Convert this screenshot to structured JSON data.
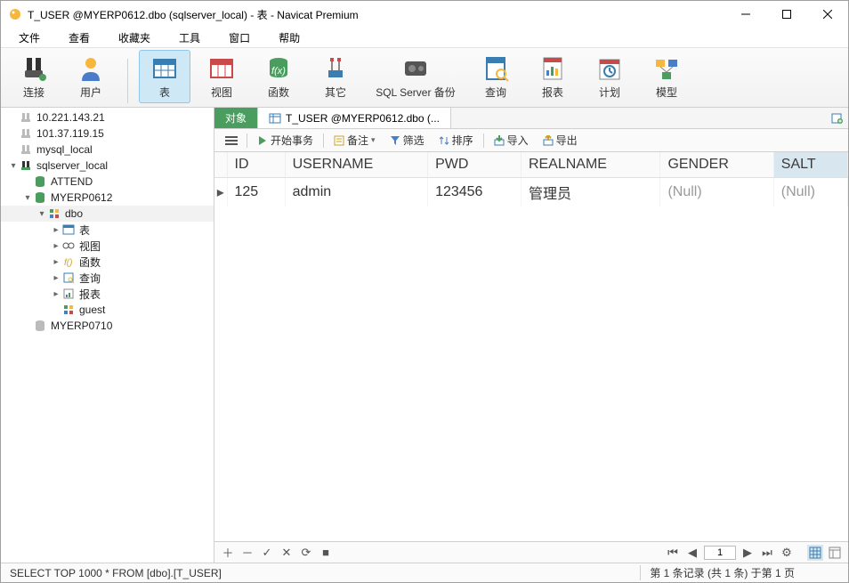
{
  "window": {
    "title": "T_USER @MYERP0612.dbo (sqlserver_local) - 表 - Navicat Premium"
  },
  "menu": [
    "文件",
    "查看",
    "收藏夹",
    "工具",
    "窗口",
    "帮助"
  ],
  "toolbar": [
    {
      "key": "conn",
      "label": "连接"
    },
    {
      "key": "user",
      "label": "用户"
    },
    {
      "key": "table",
      "label": "表",
      "active": true
    },
    {
      "key": "view",
      "label": "视图"
    },
    {
      "key": "func",
      "label": "函数"
    },
    {
      "key": "other",
      "label": "其它"
    },
    {
      "key": "backup",
      "label": "SQL Server 备份"
    },
    {
      "key": "query",
      "label": "查询"
    },
    {
      "key": "report",
      "label": "报表"
    },
    {
      "key": "plan",
      "label": "计划"
    },
    {
      "key": "model",
      "label": "模型"
    }
  ],
  "tree": [
    {
      "d": 0,
      "t": "",
      "l": "10.221.143.21",
      "i": "conn-off"
    },
    {
      "d": 0,
      "t": "",
      "l": "101.37.119.15",
      "i": "conn-off"
    },
    {
      "d": 0,
      "t": "",
      "l": "mysql_local",
      "i": "conn-off"
    },
    {
      "d": 0,
      "t": "v",
      "l": "sqlserver_local",
      "i": "conn-on"
    },
    {
      "d": 1,
      "t": "",
      "l": "ATTEND",
      "i": "db"
    },
    {
      "d": 1,
      "t": "v",
      "l": "MYERP0612",
      "i": "db"
    },
    {
      "d": 2,
      "t": "v",
      "l": "dbo",
      "i": "schema",
      "sel": true
    },
    {
      "d": 3,
      "t": ">",
      "l": "表",
      "i": "tbl"
    },
    {
      "d": 3,
      "t": ">",
      "l": "视图",
      "i": "vw"
    },
    {
      "d": 3,
      "t": ">",
      "l": "函数",
      "i": "fn"
    },
    {
      "d": 3,
      "t": ">",
      "l": "查询",
      "i": "qry"
    },
    {
      "d": 3,
      "t": ">",
      "l": "报表",
      "i": "rpt"
    },
    {
      "d": 3,
      "t": "",
      "l": "guest",
      "i": "schema"
    },
    {
      "d": 1,
      "t": "",
      "l": "MYERP0710",
      "i": "db-off"
    }
  ],
  "tabs": {
    "obj": "对象",
    "open": "T_USER @MYERP0612.dbo (..."
  },
  "ops": {
    "begin": "开始事务",
    "memo": "备注",
    "filter": "筛选",
    "sort": "排序",
    "import": "导入",
    "export": "导出"
  },
  "columns": [
    "ID",
    "USERNAME",
    "PWD",
    "REALNAME",
    "GENDER",
    "SALT"
  ],
  "rows": [
    {
      "ID": "125",
      "USERNAME": "admin",
      "PWD": "123456",
      "REALNAME": "管理员",
      "GENDER": "(Null)",
      "SALT": "(Null)"
    }
  ],
  "null_cols": [
    "GENDER",
    "SALT"
  ],
  "pager": {
    "page": "1"
  },
  "status": {
    "sql": "SELECT TOP 1000  * FROM [dbo].[T_USER]",
    "info": "第 1 条记录 (共 1 条) 于第 1 页"
  }
}
